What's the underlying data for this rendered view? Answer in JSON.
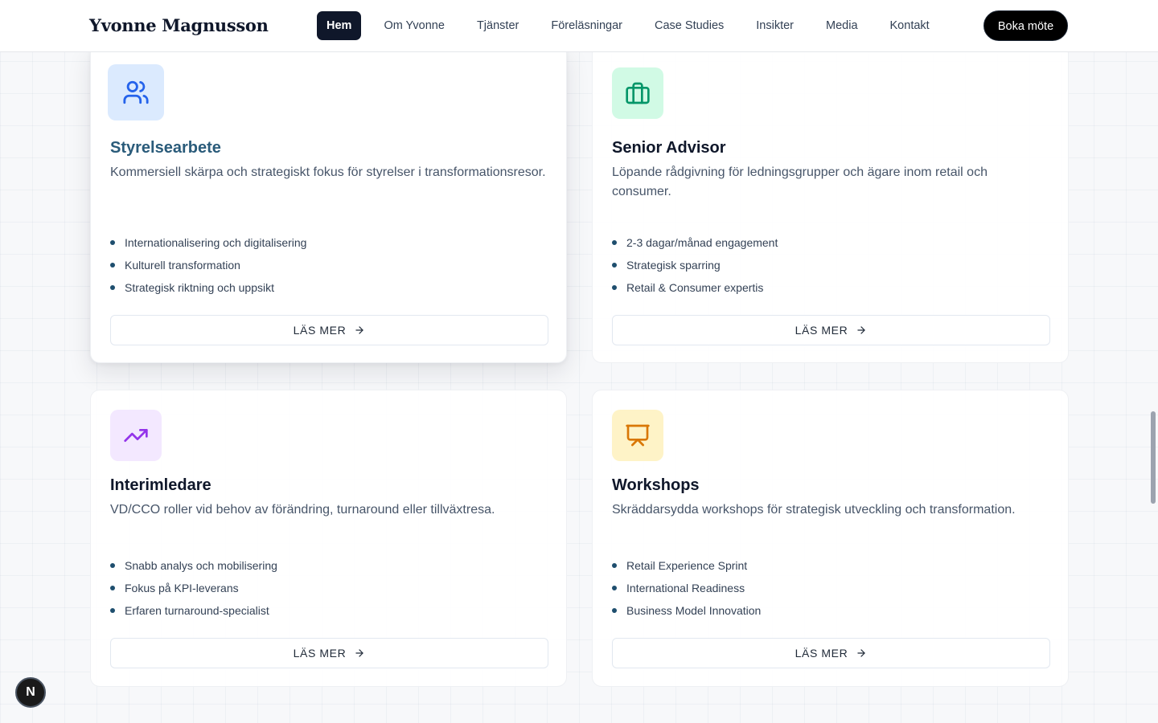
{
  "header": {
    "logo": "Yvonne Magnusson",
    "nav": [
      {
        "label": "Hem",
        "active": true
      },
      {
        "label": "Om Yvonne"
      },
      {
        "label": "Tjänster"
      },
      {
        "label": "Föreläsningar"
      },
      {
        "label": "Case Studies"
      },
      {
        "label": "Insikter"
      },
      {
        "label": "Media"
      },
      {
        "label": "Kontakt"
      }
    ],
    "cta": "Boka möte"
  },
  "cards": [
    {
      "icon": "users-icon",
      "icon_color": "#2563eb",
      "icon_bg": "#dbeafe",
      "title": "Styrelsearbete",
      "description": "Kommersiell skärpa och strategiskt fokus för styrelser i transformationsresor.",
      "bullets": [
        "Internationalisering och digitalisering",
        "Kulturell transformation",
        "Strategisk riktning och uppsikt"
      ],
      "button": "LÄS MER"
    },
    {
      "icon": "briefcase-icon",
      "icon_color": "#059669",
      "icon_bg": "#d1fae5",
      "title": "Senior Advisor",
      "description": "Löpande rådgivning för ledningsgrupper och ägare inom retail och consumer.",
      "bullets": [
        "2-3 dagar/månad engagement",
        "Strategisk sparring",
        "Retail & Consumer expertis"
      ],
      "button": "LÄS MER"
    },
    {
      "icon": "trending-up-icon",
      "icon_color": "#9333ea",
      "icon_bg": "#f3e8ff",
      "title": "Interimledare",
      "description": "VD/CCO roller vid behov av förändring, turnaround eller tillväxtresa.",
      "bullets": [
        "Snabb analys och mobilisering",
        "Fokus på KPI-leverans",
        "Erfaren turnaround-specialist"
      ],
      "button": "LÄS MER"
    },
    {
      "icon": "presentation-icon",
      "icon_color": "#d97706",
      "icon_bg": "#fef3c7",
      "title": "Workshops",
      "description": "Skräddarsydda workshops för strategisk utveckling och transformation.",
      "bullets": [
        "Retail Experience Sprint",
        "International Readiness",
        "Business Model Innovation"
      ],
      "button": "LÄS MER"
    }
  ],
  "badge": "N"
}
